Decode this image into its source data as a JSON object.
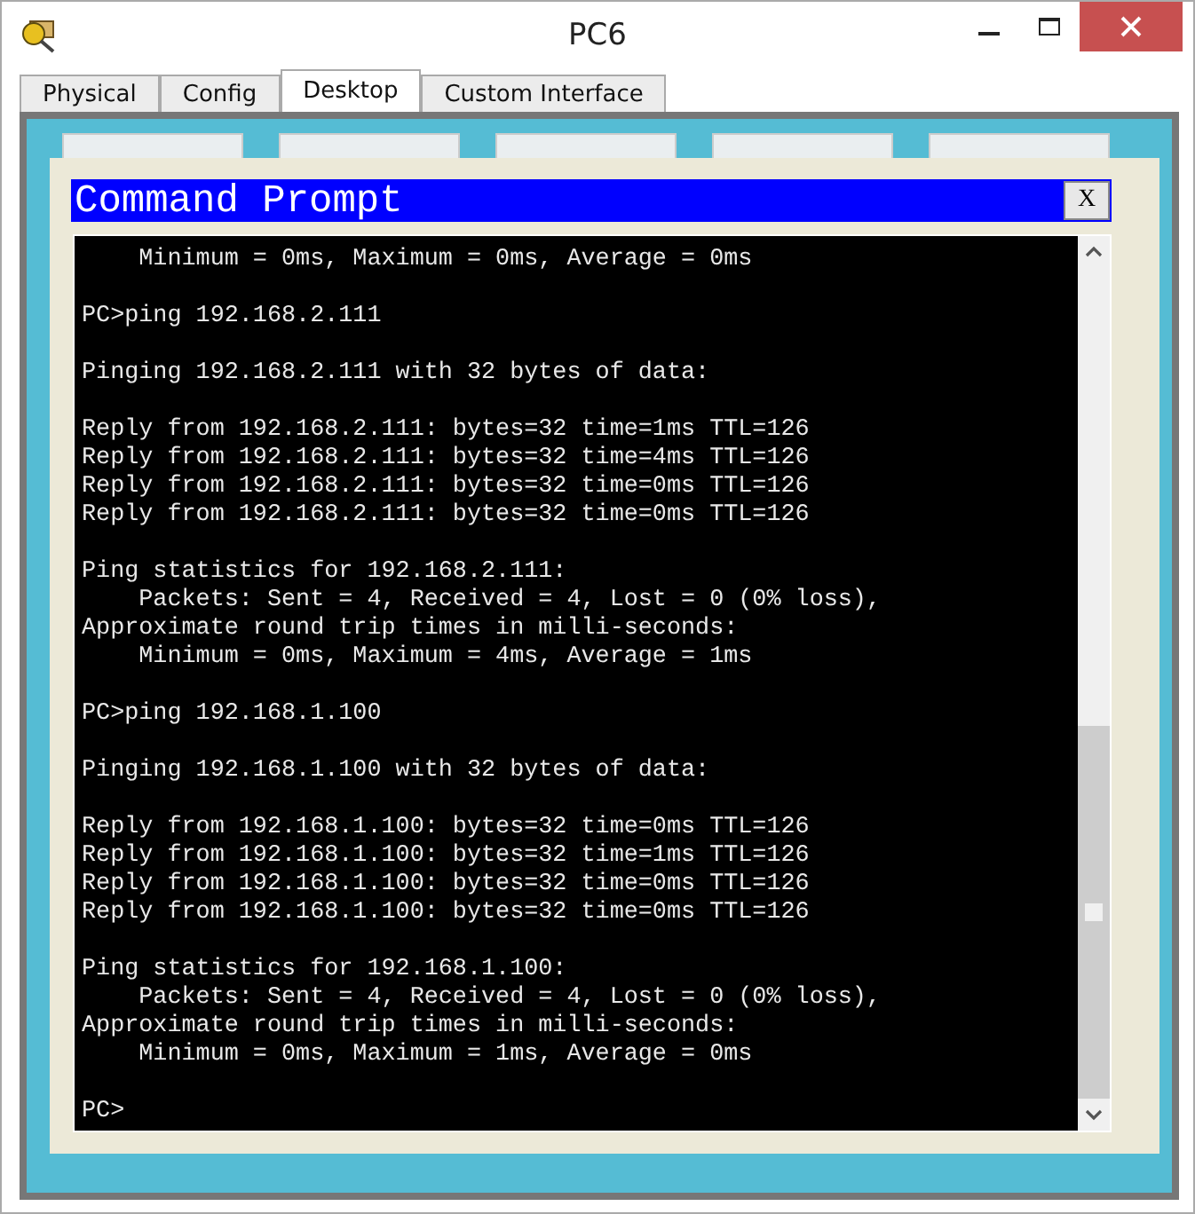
{
  "window": {
    "title": "PC6"
  },
  "tabs": [
    {
      "label": "Physical",
      "selected": false
    },
    {
      "label": "Config",
      "selected": false
    },
    {
      "label": "Desktop",
      "selected": true
    },
    {
      "label": "Custom Interface",
      "selected": false
    }
  ],
  "dialog": {
    "title": "Command Prompt",
    "close": "X",
    "blocks": [
      [
        "    Minimum = 0ms, Maximum = 0ms, Average = 0ms"
      ],
      [
        "PC>ping 192.168.2.111"
      ],
      [
        "Pinging 192.168.2.111 with 32 bytes of data:"
      ],
      [
        "Reply from 192.168.2.111: bytes=32 time=1ms TTL=126",
        "Reply from 192.168.2.111: bytes=32 time=4ms TTL=126",
        "Reply from 192.168.2.111: bytes=32 time=0ms TTL=126",
        "Reply from 192.168.2.111: bytes=32 time=0ms TTL=126"
      ],
      [
        "Ping statistics for 192.168.2.111:",
        "    Packets: Sent = 4, Received = 4, Lost = 0 (0% loss),",
        "Approximate round trip times in milli-seconds:",
        "    Minimum = 0ms, Maximum = 4ms, Average = 1ms"
      ],
      [
        "PC>ping 192.168.1.100"
      ],
      [
        "Pinging 192.168.1.100 with 32 bytes of data:"
      ],
      [
        "Reply from 192.168.1.100: bytes=32 time=0ms TTL=126",
        "Reply from 192.168.1.100: bytes=32 time=1ms TTL=126",
        "Reply from 192.168.1.100: bytes=32 time=0ms TTL=126",
        "Reply from 192.168.1.100: bytes=32 time=0ms TTL=126"
      ],
      [
        "Ping statistics for 192.168.1.100:",
        "    Packets: Sent = 4, Received = 4, Lost = 0 (0% loss),",
        "Approximate round trip times in milli-seconds:",
        "    Minimum = 0ms, Maximum = 1ms, Average = 0ms"
      ],
      [
        "PC>"
      ]
    ]
  }
}
